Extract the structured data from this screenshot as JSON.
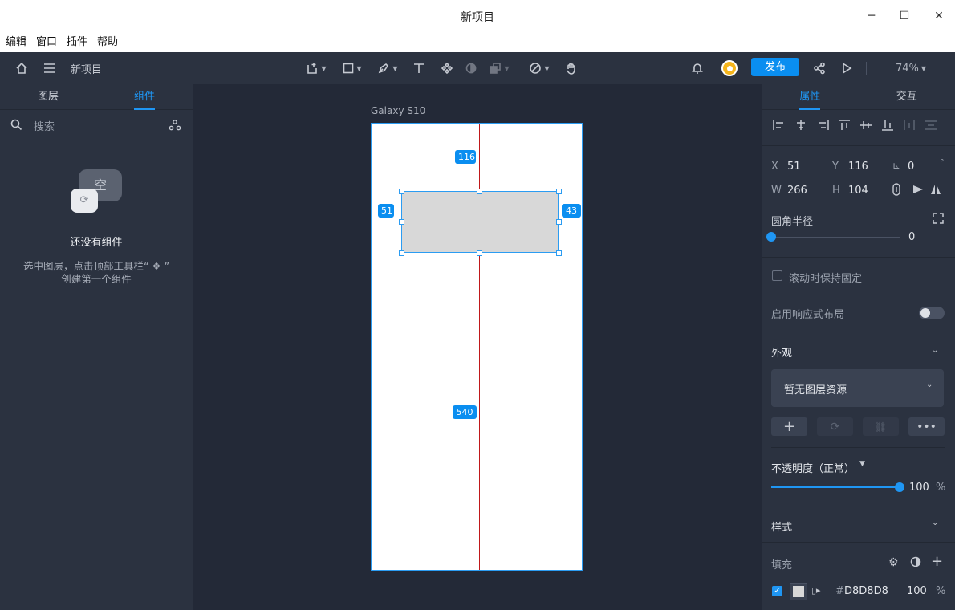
{
  "window": {
    "title": "新项目"
  },
  "menu": [
    "编辑",
    "窗口",
    "插件",
    "帮助"
  ],
  "toolbar": {
    "project_name": "新项目",
    "publish_label": "发布",
    "zoom": "74%"
  },
  "left_panel": {
    "tabs": [
      "图层",
      "组件"
    ],
    "search_placeholder": "搜索",
    "empty_badge": "空",
    "empty_title": "还没有组件",
    "empty_desc_line1": "选中图层，点击顶部工具栏“ ❖ ”",
    "empty_desc_line2": "创建第一个组件"
  },
  "canvas": {
    "artboard_name": "Galaxy S10",
    "measure_top": "116",
    "measure_left": "51",
    "measure_right": "43",
    "measure_bottom": "540"
  },
  "right_panel": {
    "tabs": [
      "属性",
      "交互"
    ],
    "x_label": "X",
    "x_value": "51",
    "y_label": "Y",
    "y_value": "116",
    "w_label": "W",
    "w_value": "266",
    "h_label": "H",
    "h_value": "104",
    "rotation_value": "0",
    "rotation_unit": "°",
    "radius_label": "圆角半径",
    "radius_value": "0",
    "fixed_label": "滚动时保持固定",
    "responsive_label": "启用响应式布局",
    "appearance_label": "外观",
    "resource_label": "暂无图层资源",
    "opacity_label": "不透明度（正常）",
    "opacity_value": "100",
    "opacity_unit": "%",
    "style_label": "样式",
    "fill_label": "填充",
    "fill_hash": "#",
    "fill_hex": "D8D8D8",
    "fill_opacity": "100",
    "fill_unit": "%"
  },
  "colors": {
    "accent": "#0a8ef0",
    "panel": "#2b3240",
    "canvas": "#232937",
    "guide": "#c0181a",
    "fill": "#d8d8d8"
  }
}
